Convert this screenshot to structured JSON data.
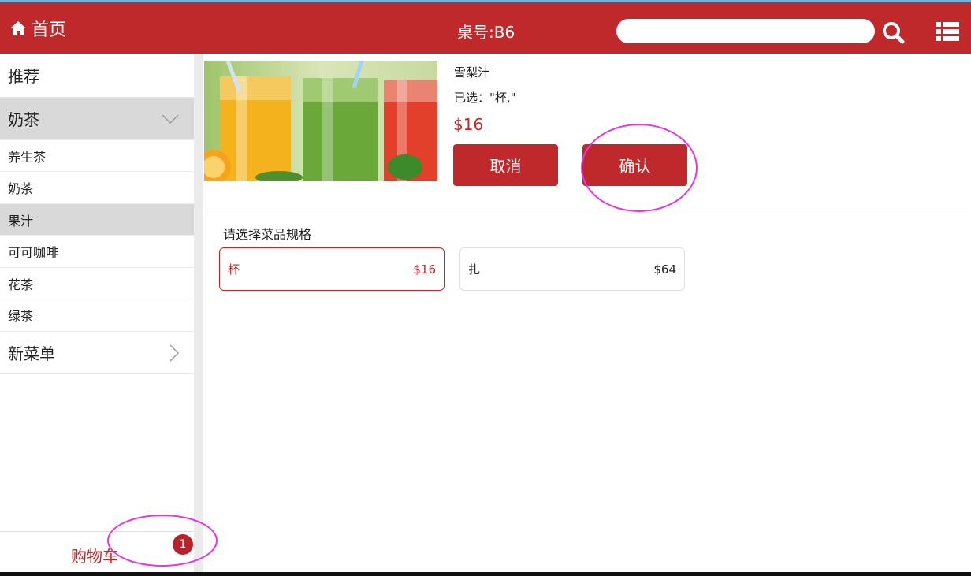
{
  "header": {
    "home_label": "首页",
    "table_label": "桌号:B6",
    "search_placeholder": "",
    "bg_color": "#c0292c"
  },
  "sidebar": {
    "categories": [
      {
        "label": "推荐"
      },
      {
        "label": "奶茶",
        "expanded": true,
        "arrow": "chevron-down-icon"
      },
      {
        "label": "新菜单",
        "arrow": "chevron-right-icon"
      }
    ],
    "subcategories": [
      {
        "label": "养生茶"
      },
      {
        "label": "奶茶"
      },
      {
        "label": "果汁",
        "active": true
      },
      {
        "label": "可可咖啡"
      },
      {
        "label": "花茶"
      },
      {
        "label": "绿茶"
      }
    ],
    "cart_label": "购物车",
    "cart_count": "1"
  },
  "product": {
    "name": "雪梨汁",
    "selected_text": "已选：\"杯,\"",
    "price": "$16",
    "cancel_label": "取消",
    "confirm_label": "确认"
  },
  "specs": {
    "title": "请选择菜品规格",
    "options": [
      {
        "name": "杯",
        "price": "$16",
        "selected": true
      },
      {
        "name": "扎",
        "price": "$64",
        "selected": false
      }
    ]
  },
  "colors": {
    "accent": "#c0292c",
    "annotation": "#e535e5"
  }
}
